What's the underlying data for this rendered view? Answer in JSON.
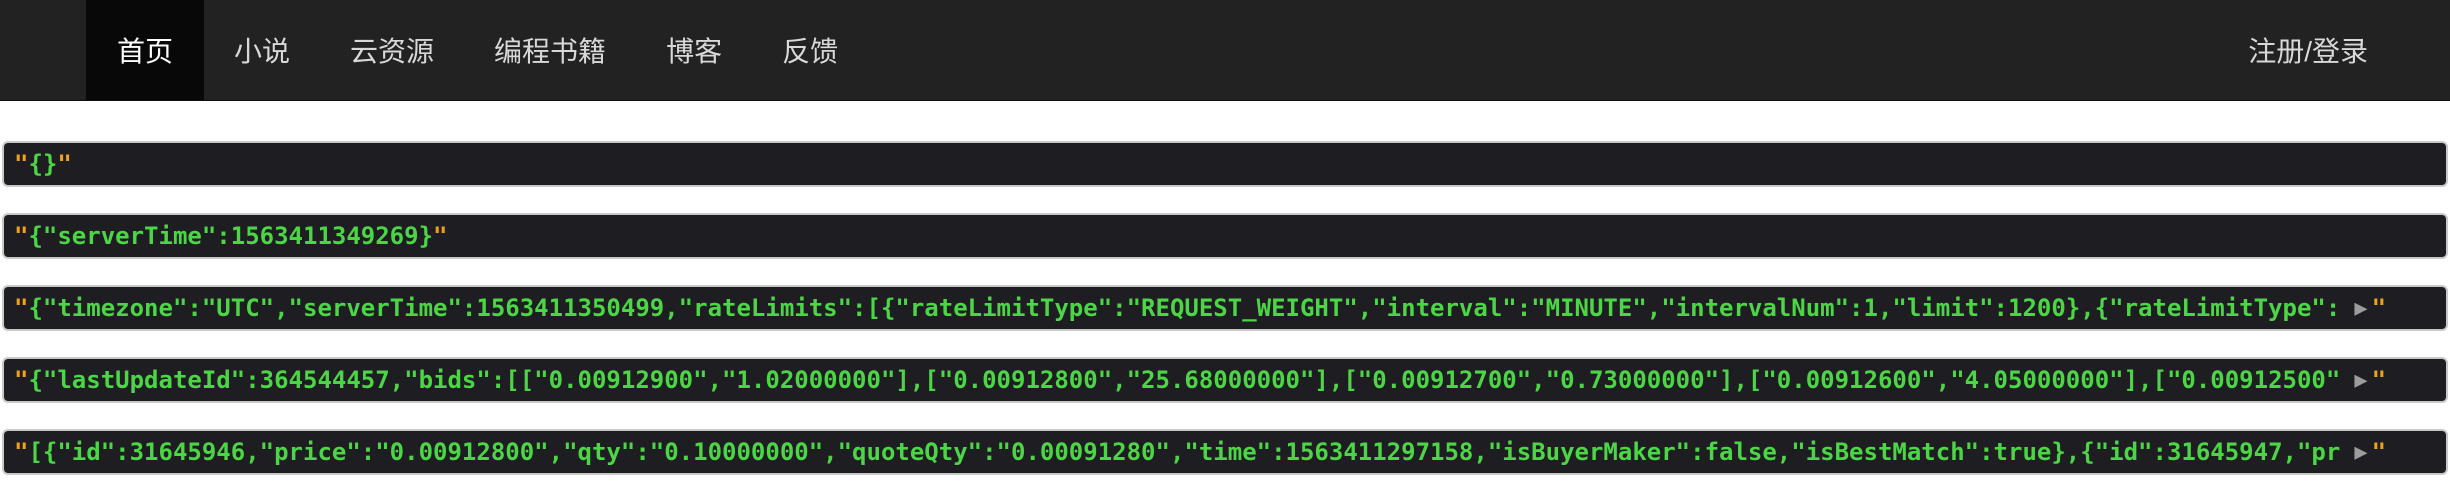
{
  "nav": {
    "items": [
      {
        "label": "首页"
      },
      {
        "label": "小说"
      },
      {
        "label": "云资源"
      },
      {
        "label": "编程书籍"
      },
      {
        "label": "博客"
      },
      {
        "label": "反馈"
      }
    ],
    "auth_label": "注册/登录"
  },
  "responses": [
    {
      "quote": "\"",
      "text": "{}",
      "quote_end": "\"",
      "truncated": false
    },
    {
      "quote": "\"",
      "text": "{\"serverTime\":1563411349269}",
      "quote_end": "\"",
      "truncated": false
    },
    {
      "quote": "\"",
      "text": "{\"timezone\":\"UTC\",\"serverTime\":1563411350499,\"rateLimits\":[{\"rateLimitType\":\"REQUEST_WEIGHT\",\"interval\":\"MINUTE\",\"intervalNum\":1,\"limit\":1200},{\"rateLimitType\":",
      "quote_end": "\"",
      "truncated": true,
      "expand": "▶"
    },
    {
      "quote": "\"",
      "text": "{\"lastUpdateId\":364544457,\"bids\":[[\"0.00912900\",\"1.02000000\"],[\"0.00912800\",\"25.68000000\"],[\"0.00912700\",\"0.73000000\"],[\"0.00912600\",\"4.05000000\"],[\"0.00912500\"",
      "quote_end": "\"",
      "truncated": true,
      "expand": "▶"
    },
    {
      "quote": "\"",
      "text": "[{\"id\":31645946,\"price\":\"0.00912800\",\"qty\":\"0.10000000\",\"quoteQty\":\"0.00091280\",\"time\":1563411297158,\"isBuyerMaker\":false,\"isBestMatch\":true},{\"id\":31645947,\"pr",
      "quote_end": "\"",
      "truncated": true,
      "expand": "▶"
    }
  ],
  "colors": {
    "navbar_bg": "#222222",
    "active_tab_bg": "#080808",
    "code_bg": "#1d1d22",
    "quote_color": "#f0a01e",
    "json_text_color": "#4cd646",
    "expand_arrow_color": "#9c9c9c"
  }
}
